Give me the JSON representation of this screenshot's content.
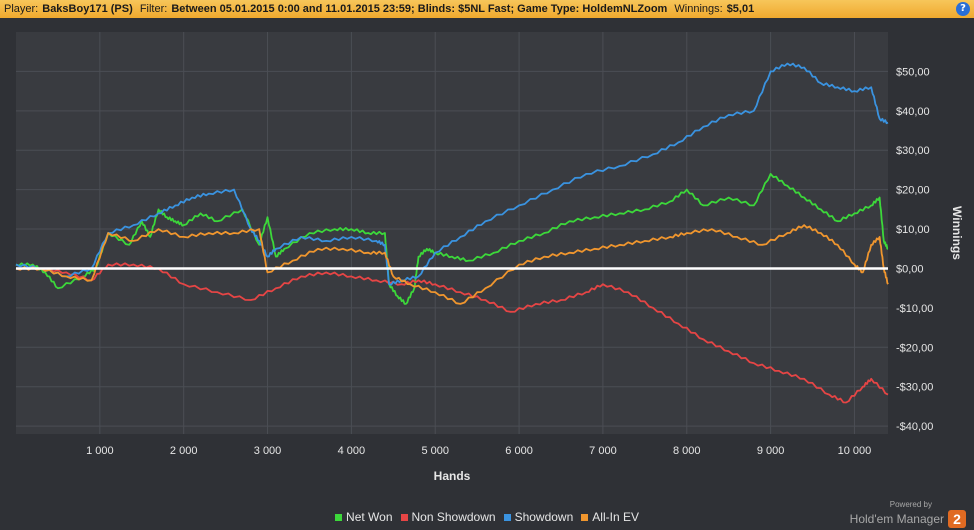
{
  "header": {
    "player_label": "Player:",
    "player_value": "BaksBoy171 (PS)",
    "filter_label": "Filter:",
    "filter_value": "Between 05.01.2015 0:00 and 11.01.2015 23:59; Blinds: $5NL Fast; Game Type: HoldemNLZoom",
    "winnings_label": "Winnings:",
    "winnings_value": "$5,01",
    "help_glyph": "?"
  },
  "branding": {
    "powered_by": "Powered by",
    "name": "Hold'em Manager",
    "logo_text": "2"
  },
  "chart_data": {
    "type": "line",
    "xlabel": "Hands",
    "ylabel": "Winnings",
    "xlim": [
      0,
      10400
    ],
    "ylim": [
      -42,
      60
    ],
    "x_ticks": [
      1000,
      2000,
      3000,
      4000,
      5000,
      6000,
      7000,
      8000,
      9000,
      10000
    ],
    "x_tick_labels": [
      "1 000",
      "2 000",
      "3 000",
      "4 000",
      "5 000",
      "6 000",
      "7 000",
      "8 000",
      "9 000",
      "10 000"
    ],
    "y_ticks": [
      50,
      40,
      30,
      20,
      10,
      0,
      -10,
      -20,
      -30,
      -40
    ],
    "y_tick_labels": [
      "$50,00",
      "$40,00",
      "$30,00",
      "$20,00",
      "$10,00",
      "$0,00",
      "-$10,00",
      "-$20,00",
      "-$30,00",
      "-$40,00"
    ],
    "grid": true,
    "legend_position": "bottom",
    "zero_line_color": "#ffffff",
    "series": [
      {
        "name": "Net Won",
        "color": "#3cd83a",
        "x": [
          0,
          200,
          350,
          500,
          800,
          950,
          1100,
          1350,
          1500,
          1600,
          1700,
          1800,
          1900,
          2000,
          2200,
          2400,
          2700,
          2900,
          3000,
          3100,
          3200,
          3500,
          3800,
          4000,
          4200,
          4400,
          4450,
          4550,
          4650,
          4750,
          4800,
          4900,
          5000,
          5200,
          5400,
          5700,
          6000,
          6300,
          6600,
          6900,
          7200,
          7500,
          7800,
          8000,
          8200,
          8500,
          8800,
          9000,
          9200,
          9400,
          9600,
          9800,
          10000,
          10200,
          10300,
          10350,
          10400
        ],
        "y": [
          1,
          1,
          -1,
          -5,
          -2,
          0,
          9,
          6,
          12,
          8,
          15,
          13,
          12,
          11,
          14,
          12,
          15,
          6,
          13,
          3,
          5,
          9,
          10,
          10,
          9,
          9,
          -4,
          -7,
          -9,
          -5,
          3,
          5,
          4,
          3,
          2,
          4,
          7,
          9,
          12,
          13,
          14,
          15,
          17,
          20,
          16,
          18,
          16,
          24,
          21,
          18,
          15,
          12,
          14,
          16,
          18,
          7,
          5
        ]
      },
      {
        "name": "Non Showdown",
        "color": "#e64545",
        "x": [
          0,
          300,
          600,
          900,
          1100,
          1400,
          1700,
          2000,
          2400,
          2800,
          3100,
          3400,
          3700,
          4000,
          4300,
          4600,
          4800,
          5000,
          5300,
          5600,
          5900,
          6200,
          6500,
          6800,
          7000,
          7300,
          7600,
          7900,
          8200,
          8500,
          8800,
          9100,
          9400,
          9700,
          9900,
          10100,
          10200,
          10400
        ],
        "y": [
          0,
          0,
          -1,
          -3,
          1,
          1,
          0,
          -4,
          -6,
          -8,
          -5,
          -2,
          -1,
          -2,
          -3,
          -4,
          -3,
          -4,
          -6,
          -8,
          -11,
          -9,
          -8,
          -6,
          -4,
          -6,
          -10,
          -14,
          -18,
          -21,
          -24,
          -26,
          -28,
          -32,
          -34,
          -30,
          -28,
          -32
        ]
      },
      {
        "name": "Showdown",
        "color": "#3a93e0",
        "x": [
          0,
          300,
          600,
          900,
          1100,
          1400,
          1700,
          1900,
          2100,
          2300,
          2600,
          2800,
          2900,
          3000,
          3100,
          3400,
          3700,
          4000,
          4300,
          4400,
          4450,
          4600,
          4800,
          5000,
          5300,
          5600,
          6000,
          6400,
          6800,
          7200,
          7600,
          7900,
          8200,
          8500,
          8800,
          9000,
          9200,
          9400,
          9600,
          9800,
          10000,
          10200,
          10300,
          10400
        ],
        "y": [
          1,
          0,
          -2,
          0,
          9,
          11,
          14,
          16,
          18,
          19,
          20,
          10,
          7,
          3,
          5,
          8,
          7,
          8,
          7,
          6,
          -4,
          -3,
          -2,
          4,
          8,
          12,
          16,
          20,
          24,
          26,
          29,
          32,
          36,
          39,
          40,
          50,
          52,
          51,
          47,
          46,
          45,
          46,
          38,
          37
        ]
      },
      {
        "name": "All-In EV",
        "color": "#f0962e",
        "x": [
          0,
          300,
          600,
          900,
          1100,
          1400,
          1700,
          2000,
          2300,
          2600,
          2900,
          3000,
          3300,
          3600,
          3900,
          4200,
          4400,
          4500,
          4700,
          5000,
          5300,
          5600,
          6000,
          6300,
          6600,
          6900,
          7200,
          7500,
          7800,
          8000,
          8300,
          8600,
          8900,
          9200,
          9400,
          9600,
          9800,
          10000,
          10100,
          10200,
          10300,
          10350,
          10400
        ],
        "y": [
          0,
          0,
          -2,
          -3,
          9,
          7,
          10,
          8,
          9,
          9,
          10,
          -1,
          2,
          5,
          5,
          4,
          4,
          -2,
          -4,
          -6,
          -9,
          -5,
          1,
          3,
          4,
          5,
          6,
          7,
          8,
          9,
          10,
          8,
          6,
          9,
          11,
          9,
          6,
          1,
          -1,
          6,
          8,
          0,
          -4
        ]
      }
    ]
  }
}
